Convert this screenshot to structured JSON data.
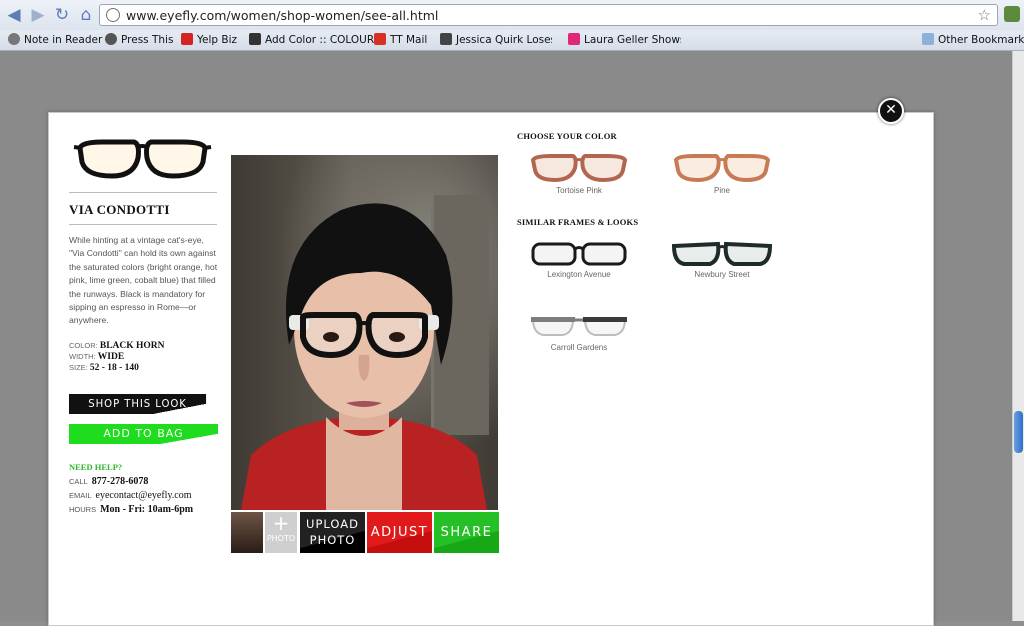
{
  "browser": {
    "url": "www.eyefly.com/women/shop-women/see-all.html",
    "bookmarks": [
      {
        "label": "Note in Reader",
        "icon": "reader-icon",
        "color": "#777777"
      },
      {
        "label": "Press This",
        "icon": "wordpress-icon",
        "color": "#555555"
      },
      {
        "label": "Yelp Biz",
        "icon": "yelp-icon",
        "color": "#d32323"
      },
      {
        "label": "Add Color :: COLOUR",
        "icon": "hearts-icon",
        "color": "#333333"
      },
      {
        "label": "TT Mail",
        "icon": "gmail-icon",
        "color": "#d93025"
      },
      {
        "label": "Jessica Quirk Loses M",
        "icon": "person-icon",
        "color": "#444444"
      },
      {
        "label": "Laura Geller Shows H",
        "icon": "laura-geller-icon",
        "color": "#e0287a"
      }
    ],
    "other_bookmarks": "Other Bookmarks"
  },
  "product": {
    "name": "VIA CONDOTTI",
    "description": "While hinting at a vintage cat's-eye, \"Via Condotti\" can hold its own against the saturated colors (bright orange, hot pink, lime green, cobalt blue) that filled the runways. Black is mandatory for sipping an espresso in Rome—or anywhere.",
    "color_label": "COLOR:",
    "color_value": "BLACK HORN",
    "width_label": "WIDTH:",
    "width_value": "WIDE",
    "size_label": "SIZE:",
    "size_value": "52 - 18 - 140",
    "shop_label": "SHOP THIS LOOK",
    "bag_label": "ADD TO BAG"
  },
  "help": {
    "title": "NEED HELP?",
    "call_label": "CALL",
    "call_value": "877-278-6078",
    "email_label": "EMAIL",
    "email_value": "eyecontact@eyefly.com",
    "hours_label": "HOURS",
    "hours_value": "Mon - Fri: 10am-6pm"
  },
  "photo_controls": {
    "plus": "+",
    "photo_label": "PHOTO",
    "upload_line1": "UPLOAD",
    "upload_line2": "PHOTO",
    "adjust": "ADJUST",
    "share": "SHARE"
  },
  "colors_section": {
    "title": "CHOOSE YOUR COLOR",
    "items": [
      {
        "name": "Tortoise Pink",
        "color": "#b2654f"
      },
      {
        "name": "Pine",
        "color": "#c87a55"
      }
    ]
  },
  "similar_section": {
    "title": "SIMILAR FRAMES & LOOKS",
    "items": [
      {
        "name": "Lexington Avenue",
        "color": "#1a1a1a"
      },
      {
        "name": "Newbury Street",
        "color": "#1e2b2b"
      },
      {
        "name": "Carroll Gardens",
        "color": "#7d7d7d"
      }
    ]
  },
  "colors": {
    "accent_green": "#1fdc1f",
    "accent_red": "#e01a1a",
    "help_green": "#2db52d"
  }
}
